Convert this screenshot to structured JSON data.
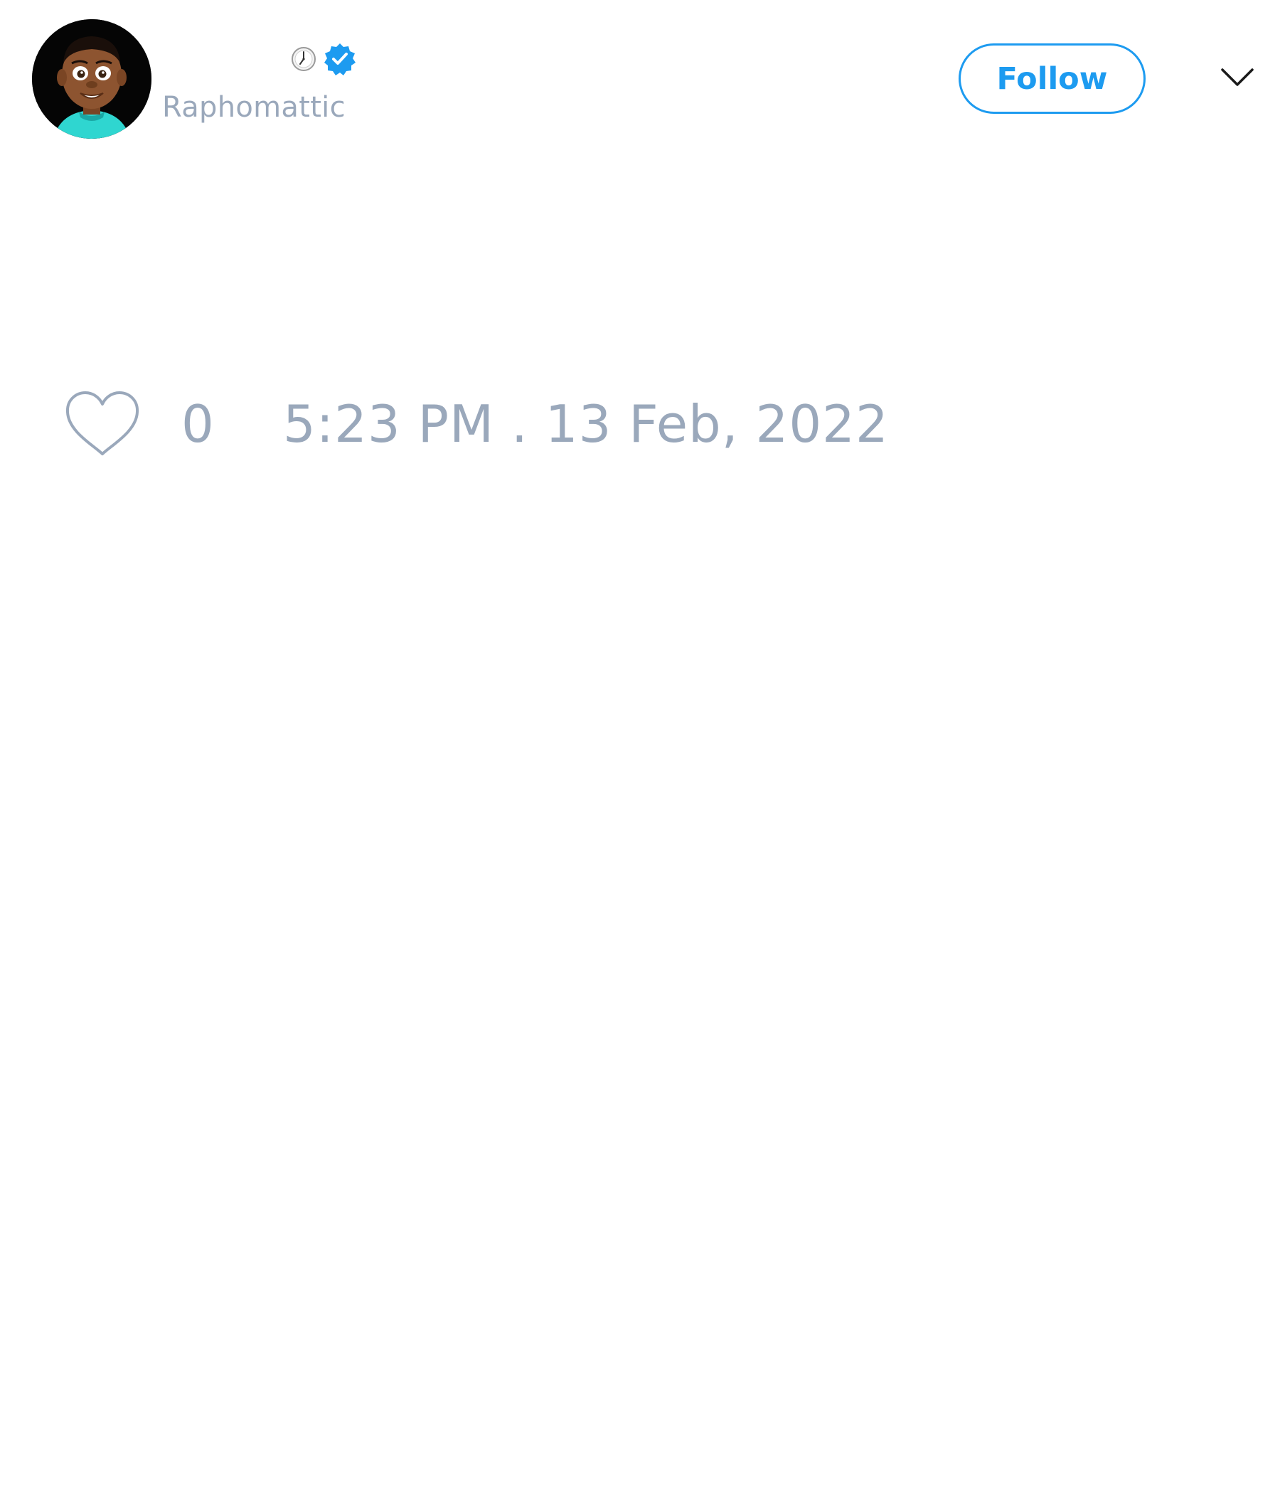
{
  "tweet": {
    "author": {
      "display_name": "",
      "handle": "Raphomattic",
      "status_emoji_icon": "clock-icon",
      "verified": true,
      "verified_icon": "verified-badge-icon",
      "avatar": "cartoon-boy-avatar"
    },
    "follow_label": "Follow",
    "menu_icon": "chevron-down-icon",
    "like": {
      "icon": "heart-icon",
      "count": "0"
    },
    "timestamp": "5:23 PM . 13 Feb, 2022"
  },
  "colors": {
    "accent": "#1d9bf0",
    "muted_text": "#9aa8bb",
    "background": "#ffffff"
  }
}
